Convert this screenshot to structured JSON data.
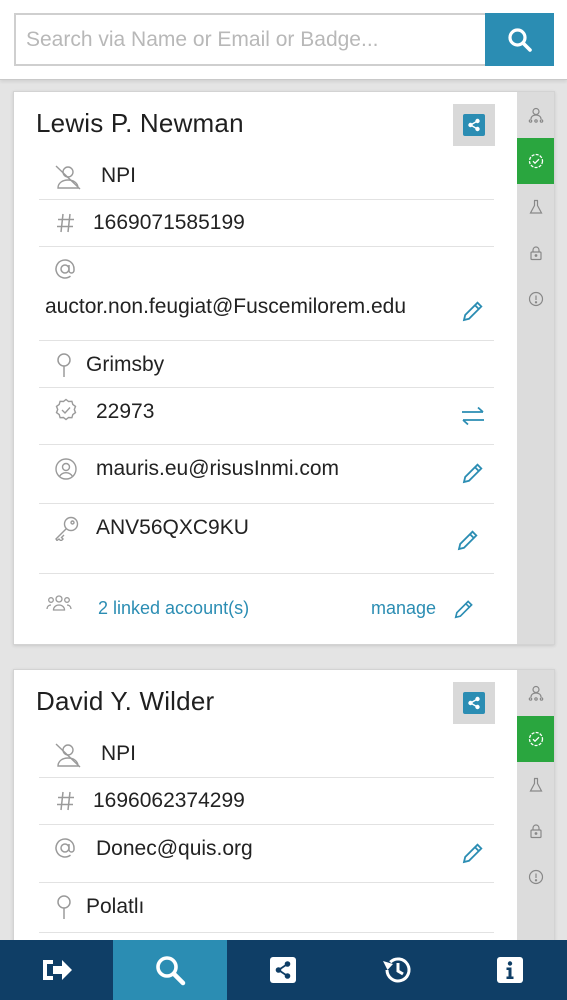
{
  "search": {
    "placeholder": "Search via Name or Email or Badge..."
  },
  "cards": [
    {
      "name": "Lewis P. Newman",
      "npi_label": "NPI",
      "number": "1669071585199",
      "email": "auctor.non.feugiat@Fuscemilorem.edu",
      "location": "Grimsby",
      "badge": "22973",
      "username": "mauris.eu@risusInmi.com",
      "key": "ANV56QXC9KU",
      "linked_accounts": "2 linked account(s)",
      "manage_label": "manage"
    },
    {
      "name": "David Y. Wilder",
      "npi_label": "NPI",
      "number": "1696062374299",
      "email": "Donec@quis.org",
      "location": "Polatlı"
    }
  ],
  "colors": {
    "accent": "#2b8db3",
    "active_green": "#2aa63f",
    "nav": "#0f3e66"
  },
  "side_rail_icons": [
    "person-network-icon",
    "badge-check-icon",
    "flask-icon",
    "lock-icon",
    "alert-circle-icon"
  ],
  "bottom_nav": [
    "logout-icon",
    "search-icon",
    "share-icon",
    "history-icon",
    "info-icon"
  ]
}
